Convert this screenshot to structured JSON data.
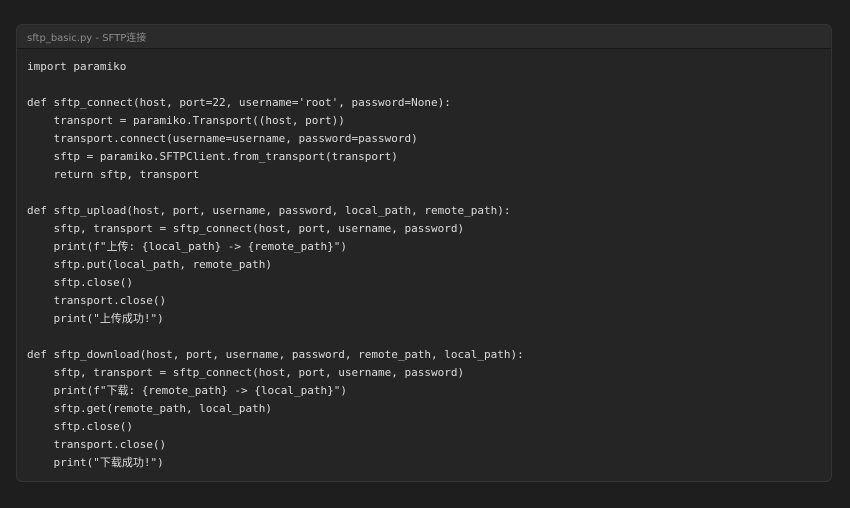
{
  "code_block": {
    "title": "sftp_basic.py - SFTP连接",
    "lines": [
      "import paramiko",
      "",
      "def sftp_connect(host, port=22, username='root', password=None):",
      "    transport = paramiko.Transport((host, port))",
      "    transport.connect(username=username, password=password)",
      "    sftp = paramiko.SFTPClient.from_transport(transport)",
      "    return sftp, transport",
      "",
      "def sftp_upload(host, port, username, password, local_path, remote_path):",
      "    sftp, transport = sftp_connect(host, port, username, password)",
      "    print(f\"上传: {local_path} -> {remote_path}\")",
      "    sftp.put(local_path, remote_path)",
      "    sftp.close()",
      "    transport.close()",
      "    print(\"上传成功!\")",
      "",
      "def sftp_download(host, port, username, password, remote_path, local_path):",
      "    sftp, transport = sftp_connect(host, port, username, password)",
      "    print(f\"下载: {remote_path} -> {local_path}\")",
      "    sftp.get(remote_path, local_path)",
      "    sftp.close()",
      "    transport.close()",
      "    print(\"下载成功!\")"
    ]
  }
}
